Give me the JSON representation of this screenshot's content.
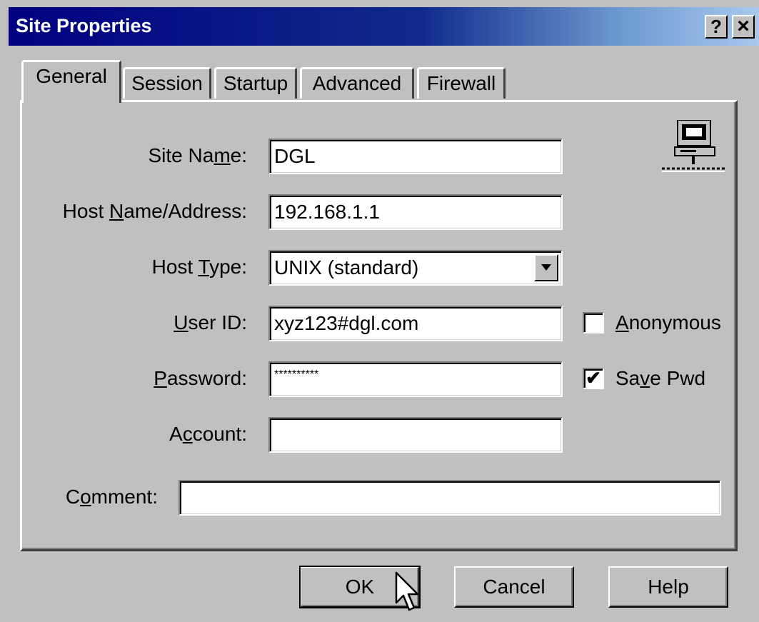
{
  "window": {
    "title": "Site Properties",
    "help_button": "?",
    "close_button": "×"
  },
  "tabs": [
    {
      "label": "General",
      "active": true
    },
    {
      "label": "Session",
      "active": false
    },
    {
      "label": "Startup",
      "active": false
    },
    {
      "label": "Advanced",
      "active": false
    },
    {
      "label": "Firewall",
      "active": false
    }
  ],
  "form": {
    "site_name": {
      "label_pre": "Site Na",
      "label_u": "m",
      "label_post": "e:",
      "value": "DGL"
    },
    "host_name": {
      "label_pre": "Host ",
      "label_u": "N",
      "label_post": "ame/Address:",
      "value": "192.168.1.1"
    },
    "host_type": {
      "label_pre": "Host ",
      "label_u": "T",
      "label_post": "ype:",
      "value": "UNIX (standard)"
    },
    "user_id": {
      "label_pre": "",
      "label_u": "U",
      "label_post": "ser ID:",
      "value": "xyz123#dgl.com"
    },
    "password": {
      "label_pre": "",
      "label_u": "P",
      "label_post": "assword:",
      "value": "**********"
    },
    "account": {
      "label_pre": "A",
      "label_u": "c",
      "label_post": "count:",
      "value": ""
    },
    "comment": {
      "label_pre": "C",
      "label_u": "o",
      "label_post": "mment:",
      "value": ""
    }
  },
  "checkboxes": {
    "anonymous": {
      "label_pre": "",
      "label_u": "A",
      "label_post": "nonymous",
      "checked": false,
      "mark": ""
    },
    "save_pwd": {
      "label_pre": "Sa",
      "label_u": "v",
      "label_post": "e Pwd",
      "checked": true,
      "mark": "✔"
    }
  },
  "buttons": {
    "ok": "OK",
    "cancel": "Cancel",
    "help": "Help"
  },
  "icons": {
    "site": "computer-icon",
    "cursor": "mouse-pointer-icon"
  }
}
